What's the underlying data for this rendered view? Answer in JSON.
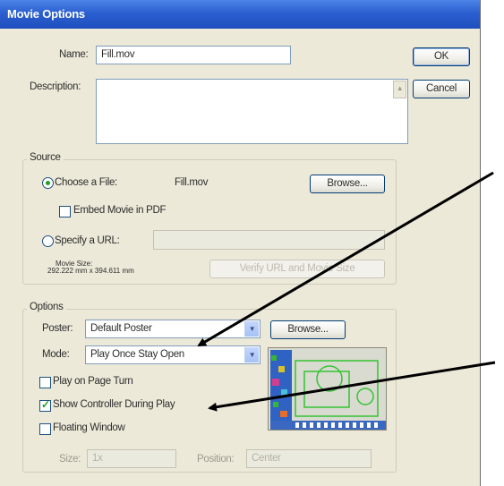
{
  "window": {
    "title": "Movie Options"
  },
  "buttons": {
    "ok": "OK",
    "cancel": "Cancel",
    "browse_source": "Browse...",
    "browse_poster": "Browse...",
    "verify_url": "Verify URL and Movie Size"
  },
  "name": {
    "label": "Name:",
    "value": "Fill.mov"
  },
  "description": {
    "label": "Description:",
    "value": ""
  },
  "source": {
    "group_label": "Source",
    "choose_file_label": "Choose a File:",
    "choose_file_value": "Fill.mov",
    "embed_label": "Embed Movie in PDF",
    "specify_url_label": "Specify a URL:",
    "url_value": "",
    "movie_size_label": "Movie Size:",
    "movie_size_value": "292.222 mm x 394.611 mm"
  },
  "options": {
    "group_label": "Options",
    "poster_label": "Poster:",
    "poster_value": "Default Poster",
    "mode_label": "Mode:",
    "mode_value": "Play Once Stay Open",
    "play_on_page_turn": "Play on Page Turn",
    "show_controller": "Show Controller During Play",
    "floating_window": "Floating Window",
    "size_label": "Size:",
    "size_value": "1x",
    "position_label": "Position:",
    "position_value": "Center"
  },
  "state": {
    "choose_file_selected": true,
    "specify_url_selected": false,
    "embed_checked": false,
    "play_on_page_turn_checked": false,
    "show_controller_checked": true,
    "floating_window_checked": false
  },
  "colors": {
    "title_bar": "#2b5fd0",
    "dialog_bg": "#ece9d8",
    "arrow": "#000000",
    "check_green": "#21a121"
  }
}
